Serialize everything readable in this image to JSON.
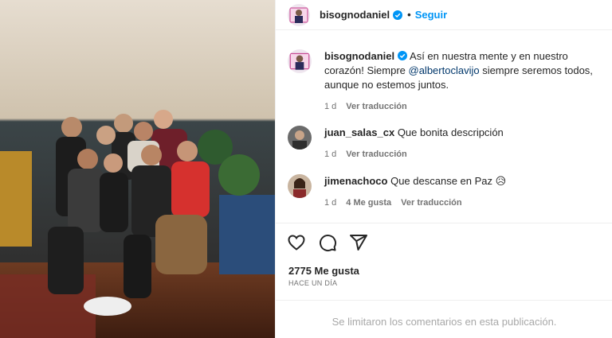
{
  "post": {
    "username": "bisognodaniel",
    "follow_label": "Seguir",
    "dot": "•"
  },
  "caption": {
    "username": "bisognodaniel",
    "text_part1": "Así en nuestra mente y en nuestro corazón! Siempre ",
    "mention": "@albertoclavijo",
    "text_part2": " siempre seremos todos, aunque no estemos juntos.",
    "time": "1 d",
    "translate": "Ver traducción"
  },
  "comments": [
    {
      "username": "juan_salas_cx",
      "text": "Que bonita descripción",
      "time": "1 d",
      "translate": "Ver traducción"
    },
    {
      "username": "jimenachoco",
      "text": "Que descanse en Paz 😥",
      "time": "1 d",
      "likes": "4 Me gusta",
      "translate": "Ver traducción"
    }
  ],
  "stats": {
    "likes": "2775 Me gusta",
    "posted": "HACE UN DÍA"
  },
  "footer": {
    "limited": "Se limitaron los comentarios en esta publicación."
  },
  "icons": {
    "like": "heart-icon",
    "comment": "comment-icon",
    "share": "share-icon",
    "verified": "verified-badge-icon"
  },
  "colors": {
    "accent": "#0095f6",
    "verified": "#0095f6",
    "mention": "#00376b",
    "muted": "#737373"
  }
}
